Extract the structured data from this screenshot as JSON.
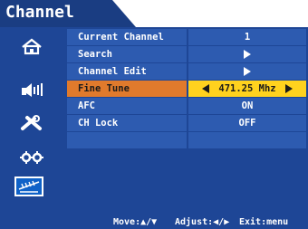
{
  "title": "Channel",
  "menu": {
    "rows": [
      {
        "label": "Current Channel",
        "value": "1"
      },
      {
        "label": "Search",
        "value": ""
      },
      {
        "label": "Channel Edit",
        "value": ""
      },
      {
        "label": "Fine Tune",
        "value": "471.25 Mhz"
      },
      {
        "label": "AFC",
        "value": "ON"
      },
      {
        "label": "CH Lock",
        "value": "OFF"
      },
      {
        "label": "",
        "value": ""
      }
    ]
  },
  "footer": {
    "move": "Move:",
    "adjust": "Adjust:",
    "exit": "Exit:menu"
  },
  "sidebar": {
    "icons": [
      "home-antenna-icon",
      "audio-icon",
      "tools-icon",
      "settings-icon",
      "channel-icon"
    ],
    "selected": "channel-icon"
  },
  "colors": {
    "panel": "#1e4696",
    "row": "#2d5bb0",
    "active_label": "#e07a2c",
    "active_value": "#ffd21e"
  }
}
